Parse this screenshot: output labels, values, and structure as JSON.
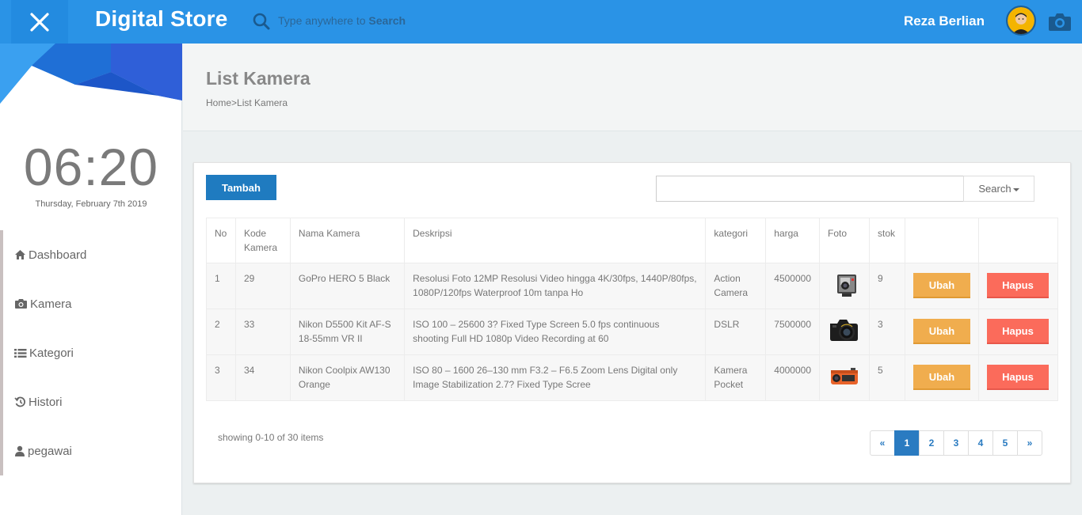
{
  "header": {
    "brand": "Digital Store",
    "search_hint_prefix": "Type anywhere to ",
    "search_hint_bold": "Search",
    "user_name": "Reza Berlian"
  },
  "sidebar": {
    "clock": "06:20",
    "date": "Thursday, February 7th 2019",
    "items": [
      {
        "label": "Dashboard",
        "icon": "home-icon"
      },
      {
        "label": "Kamera",
        "icon": "camera-icon"
      },
      {
        "label": "Kategori",
        "icon": "list-icon"
      },
      {
        "label": "Histori",
        "icon": "history-icon"
      },
      {
        "label": "pegawai",
        "icon": "user-icon"
      }
    ]
  },
  "page": {
    "title": "List Kamera",
    "breadcrumb": [
      "Home",
      "List Kamera"
    ],
    "breadcrumb_sep": ">"
  },
  "toolbar": {
    "add_label": "Tambah",
    "search_value": "",
    "search_button": "Search"
  },
  "table": {
    "headers": [
      "No",
      "Kode Kamera",
      "Nama Kamera",
      "Deskripsi",
      "kategori",
      "harga",
      "Foto",
      "stok",
      "",
      ""
    ],
    "rows": [
      {
        "no": "1",
        "kode": "29",
        "nama": "GoPro HERO 5 Black",
        "deskripsi": "Resolusi Foto 12MP Resolusi Video hingga 4K/30fps, 1440P/80fps, 1080P/120fps Waterproof 10m tanpa Ho",
        "kategori": "Action Camera",
        "harga": "4500000",
        "foto": "gopro-photo",
        "stok": "9",
        "ubah": "Ubah",
        "hapus": "Hapus"
      },
      {
        "no": "2",
        "kode": "33",
        "nama": "Nikon D5500 Kit AF-S 18-55mm VR II",
        "deskripsi": "ISO 100 – 25600 3? Fixed Type Screen 5.0 fps continuous shooting Full HD 1080p Video Recording at 60",
        "kategori": "DSLR",
        "harga": "7500000",
        "foto": "dslr-photo",
        "stok": "3",
        "ubah": "Ubah",
        "hapus": "Hapus"
      },
      {
        "no": "3",
        "kode": "34",
        "nama": "Nikon Coolpix AW130 Orange",
        "deskripsi": "ISO 80 – 1600 26–130 mm F3.2 – F6.5 Zoom Lens Digital only Image Stabilization 2.7? Fixed Type Scree",
        "kategori": "Kamera Pocket",
        "harga": "4000000",
        "foto": "coolpix-photo",
        "stok": "5",
        "ubah": "Ubah",
        "hapus": "Hapus"
      }
    ]
  },
  "footer": {
    "showing": "showing 0-10 of 30 items",
    "pages": [
      "«",
      "1",
      "2",
      "3",
      "4",
      "5",
      "»"
    ],
    "active_page": "1"
  },
  "colors": {
    "topbar": "#2a93e6",
    "primary_button": "#1f7bc0",
    "ubah": "#f0ad4e",
    "hapus": "#fb6b5b"
  }
}
